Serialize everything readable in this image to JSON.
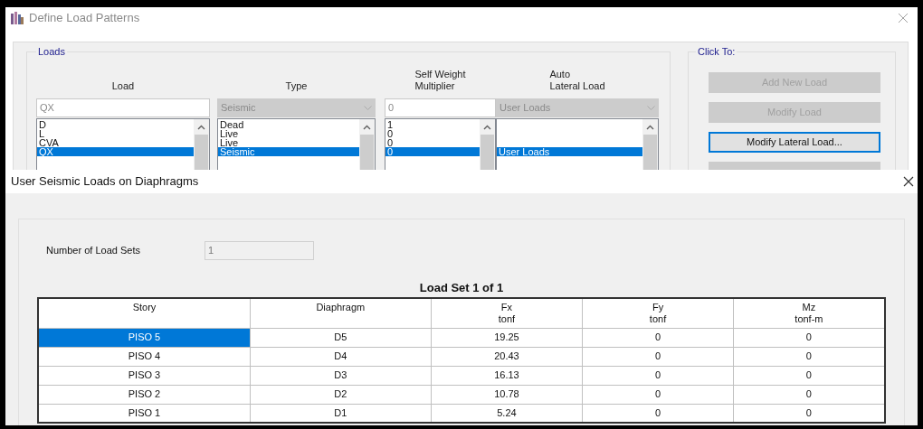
{
  "back_window": {
    "title": "Define Load Patterns",
    "loads_group": {
      "title": "Loads",
      "columns": [
        {
          "lines": [
            "Load"
          ]
        },
        {
          "lines": [
            "Type"
          ]
        },
        {
          "lines": [
            "Self Weight",
            "Multiplier"
          ]
        },
        {
          "lines": [
            "Auto",
            "Lateral Load"
          ]
        }
      ],
      "load_field": {
        "value": "QX"
      },
      "type_combo": {
        "value": "Seismic",
        "disabled": true
      },
      "multiplier_field": {
        "value": "0"
      },
      "auto_combo": {
        "value": "User Loads",
        "disabled": true
      },
      "rows": [
        {
          "load": "D",
          "type": "Dead",
          "multiplier": "1",
          "selected": false
        },
        {
          "load": "L",
          "type": "Live",
          "multiplier": "0",
          "selected": false
        },
        {
          "load": "CVA",
          "type": "Live",
          "multiplier": "0",
          "selected": false
        },
        {
          "load": "QX",
          "type": "Seismic",
          "multiplier": "0",
          "auto_lateral": "User Loads",
          "selected": true
        }
      ]
    },
    "click_group": {
      "title": "Click To:",
      "buttons": [
        {
          "label": "Add New Load",
          "disabled": true,
          "focused": false
        },
        {
          "label": "Modify Load",
          "disabled": true,
          "focused": false
        },
        {
          "label": "Modify Lateral Load...",
          "disabled": false,
          "focused": true
        },
        {
          "disabled": true,
          "focused": false
        }
      ]
    }
  },
  "dialog": {
    "title": "User Seismic Loads on Diaphragms",
    "load_sets": {
      "label": "Number of Load Sets",
      "value": "1"
    },
    "table_title": "Load Set 1 of 1",
    "table": {
      "columns": [
        {
          "lines": [
            "Story"
          ]
        },
        {
          "lines": [
            "Diaphragm"
          ]
        },
        {
          "lines": [
            "Fx",
            "tonf"
          ]
        },
        {
          "lines": [
            "Fy",
            "tonf"
          ]
        },
        {
          "lines": [
            "Mz",
            "tonf-m"
          ]
        }
      ],
      "rows": [
        {
          "cells": [
            "PISO 5",
            "D5",
            "19.25",
            "0",
            "0"
          ],
          "selected": true
        },
        {
          "cells": [
            "PISO 4",
            "D4",
            "20.43",
            "0",
            "0"
          ],
          "selected": false
        },
        {
          "cells": [
            "PISO 3",
            "D3",
            "16.13",
            "0",
            "0"
          ],
          "selected": false
        },
        {
          "cells": [
            "PISO 2",
            "D2",
            "10.78",
            "0",
            "0"
          ],
          "selected": false
        },
        {
          "cells": [
            "PISO 1",
            "D1",
            "5.24",
            "0",
            "0"
          ],
          "selected": false
        }
      ]
    }
  }
}
